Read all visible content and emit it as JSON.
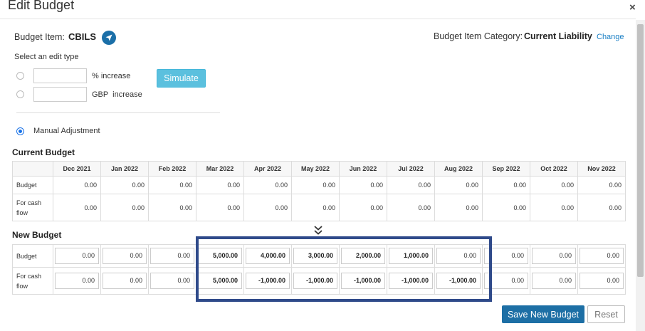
{
  "modal": {
    "title": "Edit Budget",
    "close_label": "×"
  },
  "budget_item": {
    "label": "Budget Item:",
    "value": "CBILS",
    "icon": "navigation-arrow-icon",
    "category_label": "Budget Item Category:",
    "category_value": "Current Liability",
    "change_label": "Change"
  },
  "edit_type": {
    "prompt": "Select an edit type",
    "options": [
      {
        "label": "% increase",
        "value": "",
        "checked": false
      },
      {
        "label": "GBP  increase",
        "value": "",
        "checked": false
      }
    ],
    "simulate_label": "Simulate",
    "manual_label": "Manual Adjustment",
    "manual_checked": true
  },
  "current_budget": {
    "title": "Current Budget",
    "months": [
      "Dec 2021",
      "Jan 2022",
      "Feb 2022",
      "Mar 2022",
      "Apr 2022",
      "May 2022",
      "Jun 2022",
      "Jul 2022",
      "Aug 2022",
      "Sep 2022",
      "Oct 2022",
      "Nov 2022"
    ],
    "rows": [
      {
        "label": "Budget",
        "values": [
          "0.00",
          "0.00",
          "0.00",
          "0.00",
          "0.00",
          "0.00",
          "0.00",
          "0.00",
          "0.00",
          "0.00",
          "0.00",
          "0.00"
        ]
      },
      {
        "label": "For cash flow",
        "values": [
          "0.00",
          "0.00",
          "0.00",
          "0.00",
          "0.00",
          "0.00",
          "0.00",
          "0.00",
          "0.00",
          "0.00",
          "0.00",
          "0.00"
        ]
      }
    ]
  },
  "new_budget": {
    "title": "New Budget",
    "rows": [
      {
        "label": "Budget",
        "values": [
          "0.00",
          "0.00",
          "0.00",
          "5,000.00",
          "4,000.00",
          "3,000.00",
          "2,000.00",
          "1,000.00",
          "0.00",
          "0.00",
          "0.00",
          "0.00"
        ]
      },
      {
        "label": "For cash flow",
        "values": [
          "0.00",
          "0.00",
          "0.00",
          "5,000.00",
          "-1,000.00",
          "-1,000.00",
          "-1,000.00",
          "-1,000.00",
          "-1,000.00",
          "0.00",
          "0.00",
          "0.00"
        ]
      }
    ],
    "bold_cells": [
      3,
      4,
      5,
      6,
      7,
      8
    ]
  },
  "actions": {
    "save_label": "Save New Budget",
    "reset_label": "Reset"
  },
  "colors": {
    "primary": "#1d6fa5",
    "simulate": "#5bc0de",
    "highlight_border": "#2f4a8a",
    "link": "#1a7fc4"
  }
}
